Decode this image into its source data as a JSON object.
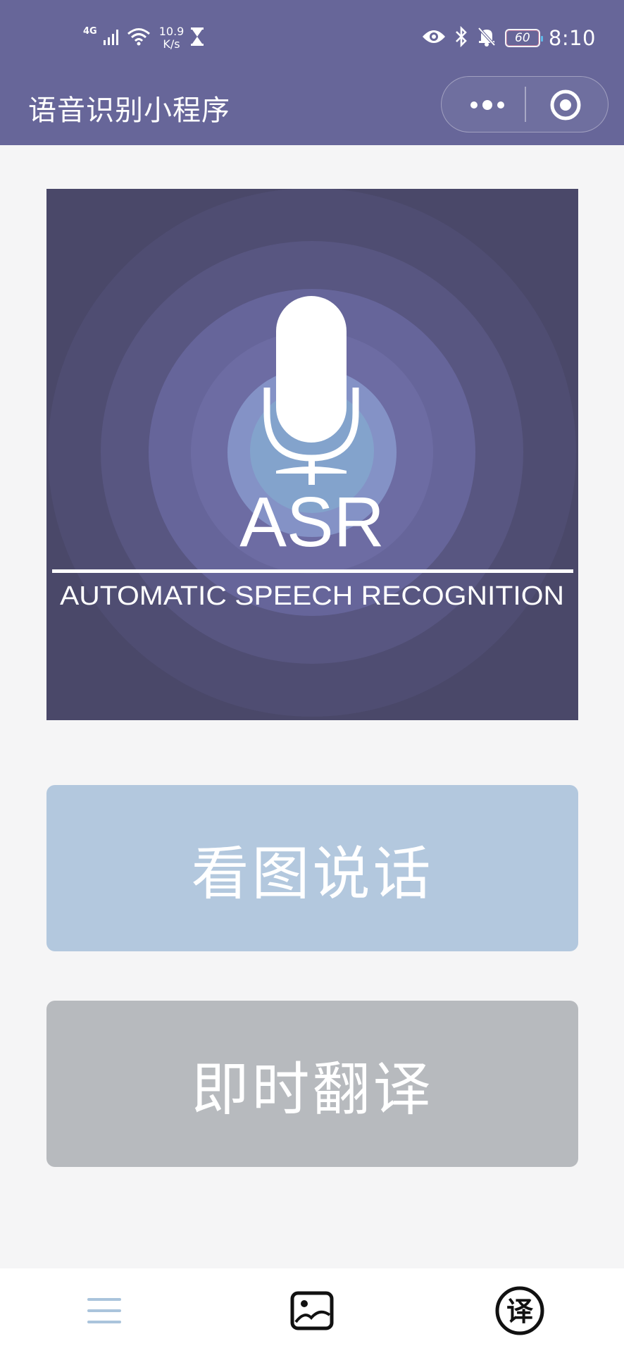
{
  "status_bar": {
    "network": "4G",
    "speed_value": "10.9",
    "speed_unit": "K/s",
    "battery": "60",
    "time": "8:10"
  },
  "nav": {
    "title": "语音识别小程序"
  },
  "hero": {
    "main_text": "ASR",
    "sub_text": "AUTOMATIC SPEECH RECOGNITION"
  },
  "buttons": {
    "picture_talk": "看图说话",
    "instant_translate": "即时翻译"
  },
  "tabbar": {
    "items": [
      {
        "icon": "menu-icon"
      },
      {
        "icon": "image-icon"
      },
      {
        "icon": "translate-icon",
        "glyph": "译"
      }
    ]
  },
  "colors": {
    "header": "#676699",
    "background": "#f5f5f6",
    "btn_picture": "#b3c8de",
    "btn_translate": "#b7babe"
  }
}
